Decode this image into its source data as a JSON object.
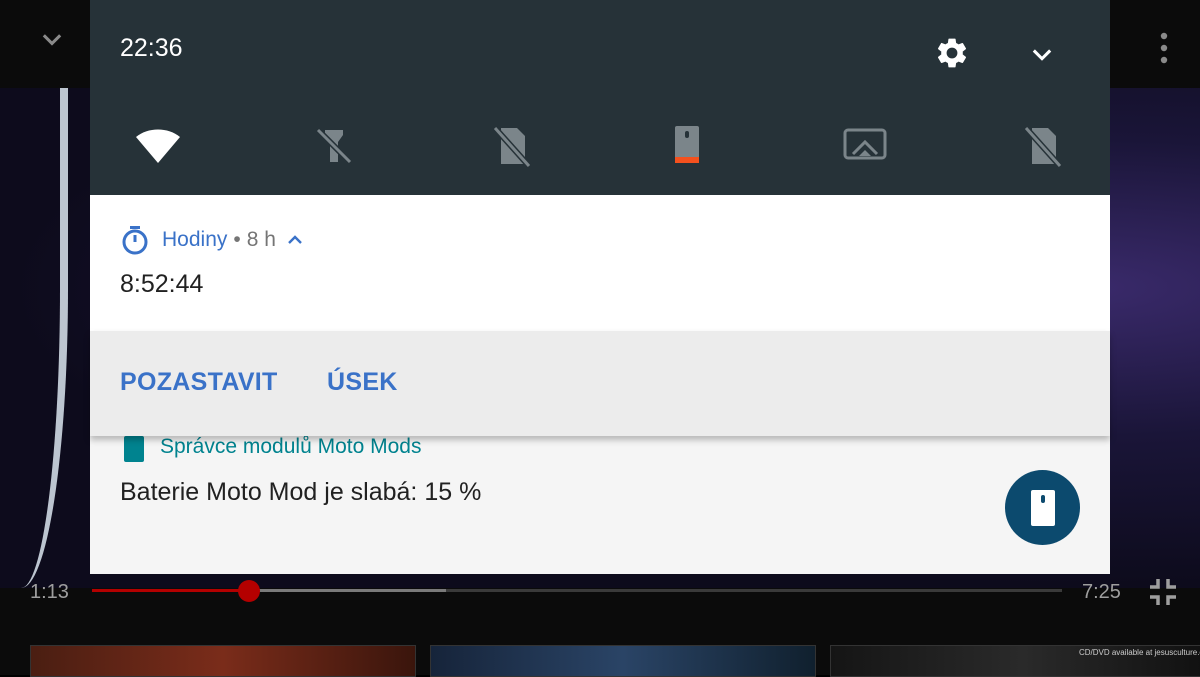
{
  "background_app": {
    "current_time": "1:13",
    "duration": "7:25",
    "playback_progress": 0.162,
    "buffered_progress": 0.365,
    "thumbnail_caption": "CD/DVD available at jesusculture.org",
    "icons": [
      "chevron-down-icon",
      "more-vert-icon",
      "fullscreen-exit-icon"
    ]
  },
  "status_bar": {
    "time": "22:36",
    "icons": [
      "settings-icon",
      "collapse-chevron-icon"
    ]
  },
  "quick_settings": [
    {
      "name": "wifi",
      "icon": "wifi-icon",
      "active": true
    },
    {
      "name": "flashlight",
      "icon": "flashlight-off-icon",
      "active": false
    },
    {
      "name": "mobile-data",
      "icon": "sim-off-icon",
      "active": false
    },
    {
      "name": "moto-mod",
      "icon": "moto-mod-battery-icon",
      "active": true,
      "battery_color": "#f4511e"
    },
    {
      "name": "cast",
      "icon": "cast-icon",
      "active": false
    },
    {
      "name": "sim",
      "icon": "sim-off-icon",
      "active": false
    }
  ],
  "notifications": [
    {
      "app": "Hodiny",
      "separator": "•",
      "age": "8 h",
      "text": "8:52:44",
      "icon": "stopwatch-icon",
      "accent": "#3a72c8",
      "actions": [
        "POZASTAVIT",
        "ÚSEK"
      ]
    },
    {
      "app": "Správce modulů Moto Mods",
      "text": "Baterie Moto Mod je slabá: 15 %",
      "icon": "moto-mod-icon",
      "accent": "#00838f",
      "fab_icon": "moto-mod-icon",
      "fab_color": "#0c4a6e"
    }
  ]
}
